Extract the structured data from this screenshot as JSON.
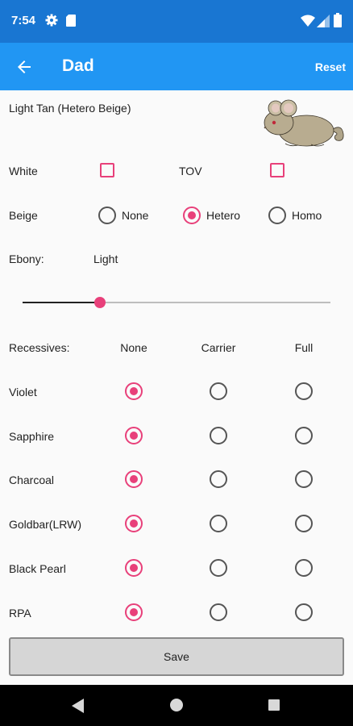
{
  "status_bar": {
    "time": "7:54"
  },
  "app_bar": {
    "title": "Dad",
    "reset_label": "Reset"
  },
  "summary": {
    "color_name": "Light Tan (Hetero Beige)",
    "image_icon": "chinchilla-image"
  },
  "white": {
    "label": "White",
    "checked": false
  },
  "tov": {
    "label": "TOV",
    "checked": false
  },
  "beige": {
    "label": "Beige",
    "options": [
      "None",
      "Hetero",
      "Homo"
    ],
    "selected": "Hetero"
  },
  "ebony": {
    "label": "Ebony:",
    "value_label": "Light",
    "slider_fraction": 0.25
  },
  "recessives": {
    "label": "Recessives:",
    "columns": [
      "None",
      "Carrier",
      "Full"
    ],
    "rows": [
      {
        "name": "Violet",
        "selected": "None"
      },
      {
        "name": "Sapphire",
        "selected": "None"
      },
      {
        "name": "Charcoal",
        "selected": "None"
      },
      {
        "name": "Goldbar(LRW)",
        "selected": "None"
      },
      {
        "name": "Black Pearl",
        "selected": "None"
      },
      {
        "name": "RPA",
        "selected": "None"
      }
    ]
  },
  "save_label": "Save",
  "colors": {
    "status_bar": "#1976d2",
    "app_bar": "#2196f3",
    "accent": "#e8407a"
  }
}
